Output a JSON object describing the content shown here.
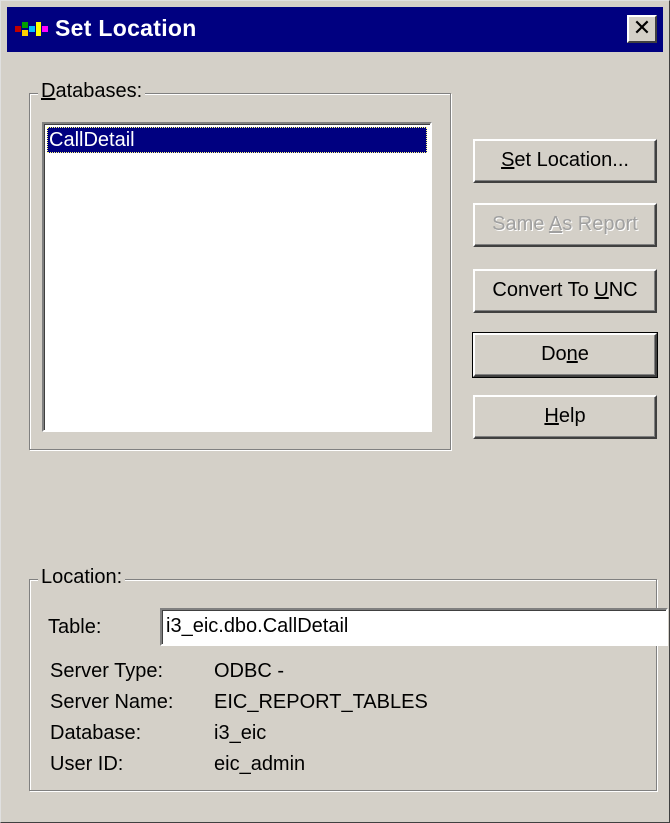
{
  "window": {
    "title": "Set Location",
    "close_symbol": "✕"
  },
  "databases": {
    "label_prefix": "",
    "label_accel": "D",
    "label_rest": "atabases:",
    "items": [
      "CallDetail"
    ],
    "selected_index": 0
  },
  "buttons": {
    "set_location": {
      "pre": "",
      "accel": "S",
      "post": "et Location...",
      "enabled": true
    },
    "same_as_report": {
      "pre": "Same ",
      "accel": "A",
      "post": "s Report",
      "enabled": false
    },
    "convert_to_unc": {
      "pre": "Convert To ",
      "accel": "U",
      "post": "NC",
      "enabled": true
    },
    "done": {
      "pre": "Do",
      "accel": "n",
      "post": "e",
      "enabled": true,
      "default": true
    },
    "help": {
      "pre": "",
      "accel": "H",
      "post": "elp",
      "enabled": true
    }
  },
  "location": {
    "label": "Location:",
    "table_label": "Table:",
    "table_value": "i3_eic.dbo.CallDetail",
    "server_type_label": "Server Type:",
    "server_type_value": "ODBC -",
    "server_name_label": "Server Name:",
    "server_name_value": "EIC_REPORT_TABLES",
    "database_label": "Database:",
    "database_value": "i3_eic",
    "user_id_label": "User ID:",
    "user_id_value": "eic_admin"
  },
  "colors": {
    "titlebar": "#000080",
    "face": "#d4d0c8",
    "selection": "#000080"
  },
  "icons": {
    "title": "crystal-reports-app-icon",
    "close": "close-icon"
  }
}
